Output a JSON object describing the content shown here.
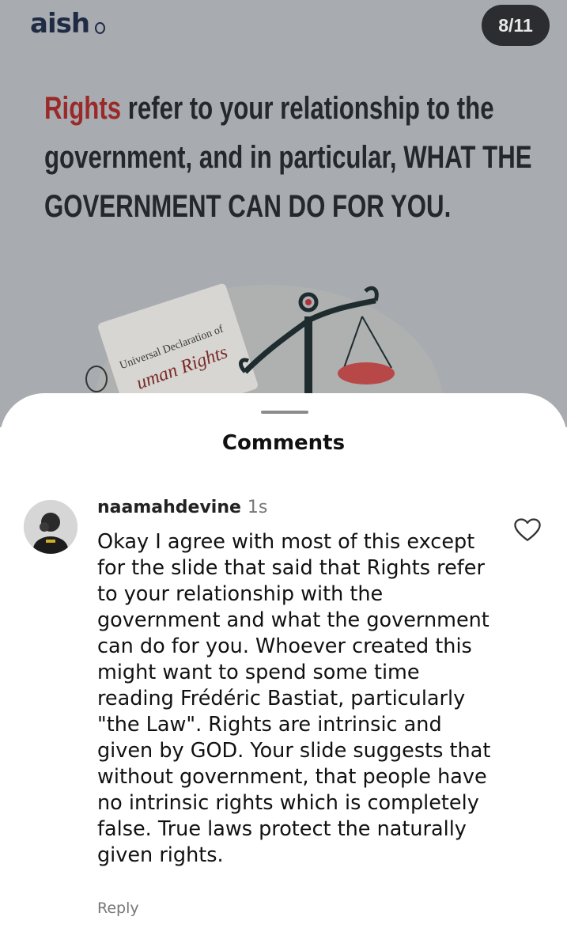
{
  "slide": {
    "brand": "aish",
    "counter": "8/11",
    "headline_red": "Rights",
    "headline_line1": " refer to your relationship to the",
    "headline_line2": "government, and in particular, WHAT THE",
    "headline_line3": "GOVERNMENT CAN DO FOR YOU.",
    "document_title": "Universal Declaration of",
    "document_subtitle": "uman Rights"
  },
  "comments_sheet": {
    "title": "Comments",
    "comment": {
      "username": "naamahdevine",
      "timestamp": "1s",
      "text": "Okay I agree with most of this except for the slide that said that Rights refer to your relationship with the government and what the government can do for you. Whoever created this might want to spend some time reading Frédéric Bastiat, particularly \"the Law\". Rights are intrinsic and given by GOD. Your slide suggests that without government, that people have no intrinsic rights which is completely false. True laws protect the naturally given rights.",
      "reply_label": "Reply"
    }
  },
  "colors": {
    "slide_bg": "#a8acb0",
    "accent_red": "#9a2a2a",
    "sheet_bg": "#ffffff"
  },
  "icons": [
    "heart-icon",
    "avatar"
  ]
}
